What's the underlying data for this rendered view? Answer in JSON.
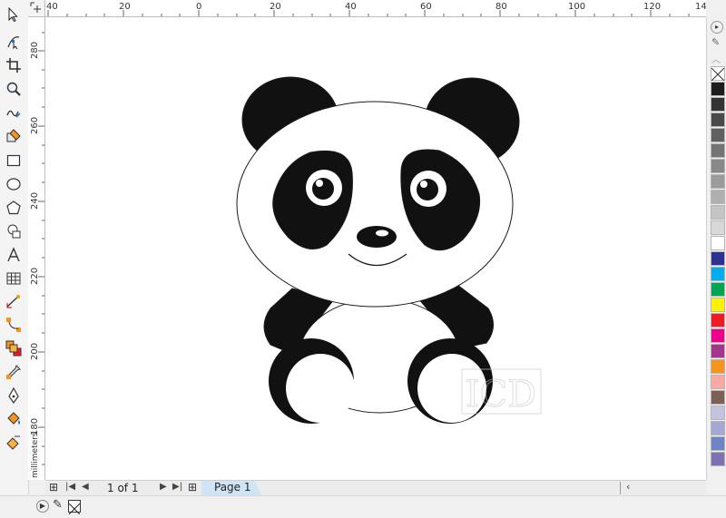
{
  "toolbox": {
    "tools": [
      {
        "name": "pick-tool",
        "icon": "cursor-arrow-icon"
      },
      {
        "name": "shape-tool",
        "icon": "node-edit-icon"
      },
      {
        "name": "crop-tool",
        "icon": "crop-icon"
      },
      {
        "name": "zoom-tool",
        "icon": "magnifier-icon"
      },
      {
        "name": "freehand-tool",
        "icon": "freehand-icon"
      },
      {
        "name": "smart-fill-tool",
        "icon": "smart-fill-icon"
      },
      {
        "name": "rectangle-tool",
        "icon": "rectangle-icon"
      },
      {
        "name": "ellipse-tool",
        "icon": "ellipse-icon"
      },
      {
        "name": "polygon-tool",
        "icon": "polygon-icon"
      },
      {
        "name": "basic-shapes-tool",
        "icon": "basic-shapes-icon"
      },
      {
        "name": "text-tool",
        "icon": "text-a-icon"
      },
      {
        "name": "table-tool",
        "icon": "table-icon"
      },
      {
        "name": "dimension-tool",
        "icon": "dimension-icon"
      },
      {
        "name": "connector-tool",
        "icon": "connector-icon"
      },
      {
        "name": "blend-tool",
        "icon": "blend-icon"
      },
      {
        "name": "eyedropper-tool",
        "icon": "eyedropper-icon"
      },
      {
        "name": "outline-pen-tool",
        "icon": "pen-nib-icon"
      },
      {
        "name": "fill-tool",
        "icon": "paint-bucket-icon"
      },
      {
        "name": "interactive-fill-tool",
        "icon": "interactive-fill-icon"
      }
    ]
  },
  "rulers": {
    "unit": "millimeters",
    "horizontal_ticks": [
      "40",
      "20",
      "0",
      "20",
      "40",
      "60",
      "80",
      "100",
      "120",
      "14"
    ],
    "vertical_ticks": [
      "280",
      "260",
      "240",
      "220",
      "200",
      "180"
    ]
  },
  "canvas": {
    "watermark": "ICD",
    "colors": {
      "fill_black": "#111111",
      "outline": "#1a1a1a",
      "white": "#ffffff"
    }
  },
  "palette": {
    "swatches": [
      "#1c1c1c",
      "#333333",
      "#4a4a4a",
      "#606060",
      "#747474",
      "#888888",
      "#9c9c9c",
      "#b0b0b0",
      "#c4c4c4",
      "#d8d8d8",
      "#ffffff",
      "#2e3192",
      "#00aeef",
      "#00a651",
      "#fff200",
      "#ed1c24",
      "#ec008c",
      "#a3358c",
      "#f7941d",
      "#f9aaa4",
      "#7d6157",
      "#c5c1e1",
      "#a5a7d4",
      "#6c85c4",
      "#7e70b4"
    ]
  },
  "pagebar": {
    "page_count": "1 of 1",
    "page_tab": "Page 1"
  }
}
